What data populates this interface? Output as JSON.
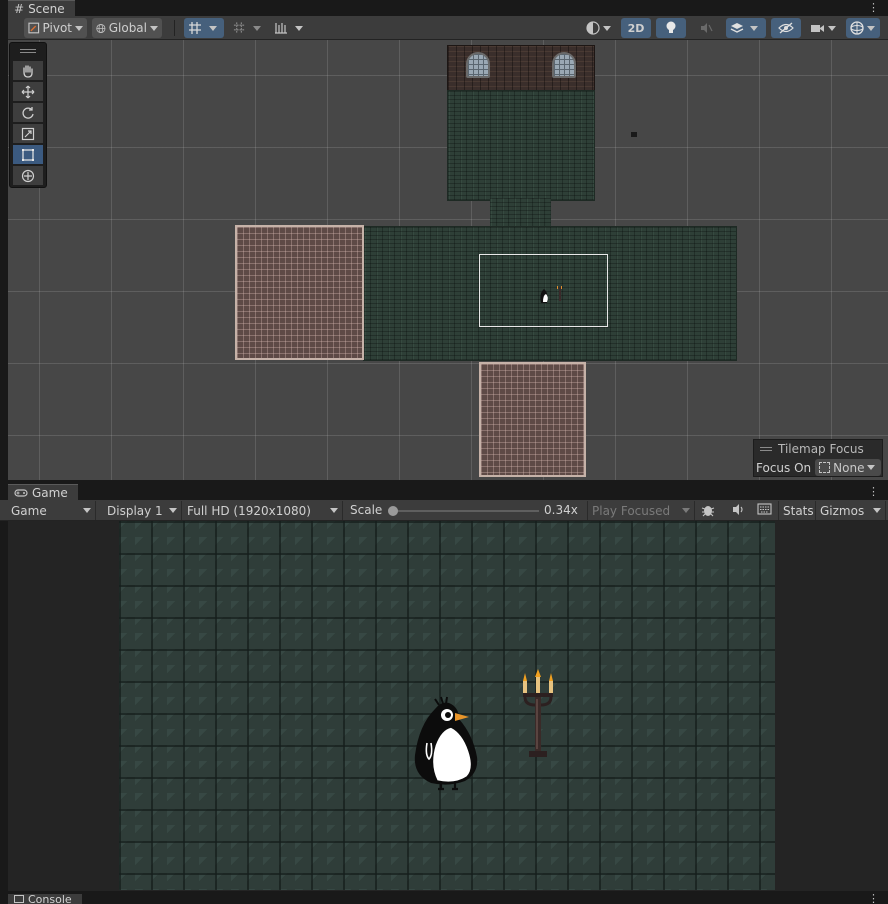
{
  "scene_tab": {
    "title": "Scene",
    "icon": "grid-hash-icon"
  },
  "scene_toolbar": {
    "pivot_label": "Pivot",
    "global_label": "Global",
    "mode_2d_label": "2D"
  },
  "tools": [
    "hand-tool-icon",
    "move-tool-icon",
    "rotate-tool-icon",
    "scale-tool-icon",
    "rect-tool-icon",
    "transform-tool-icon"
  ],
  "tilemap_focus": {
    "title": "Tilemap Focus",
    "focus_on_label": "Focus On",
    "focus_value": "None"
  },
  "game_tab": {
    "title": "Game",
    "icon": "gamepad-icon"
  },
  "game_toolbar": {
    "view_select": "Game",
    "display_select": "Display 1",
    "resolution_select": "Full HD (1920x1080)",
    "scale_label": "Scale",
    "scale_value": "0.34x",
    "scale_fraction": 0.0,
    "play_focused": "Play Focused",
    "stats_label": "Stats",
    "gizmos_label": "Gizmos"
  },
  "console_tab": {
    "title": "Console"
  },
  "colors": {
    "panel_bg": "#3c3c3c",
    "scene_bg": "#474747",
    "active_button": "#46607c",
    "game_floor": "#2f3d39"
  }
}
